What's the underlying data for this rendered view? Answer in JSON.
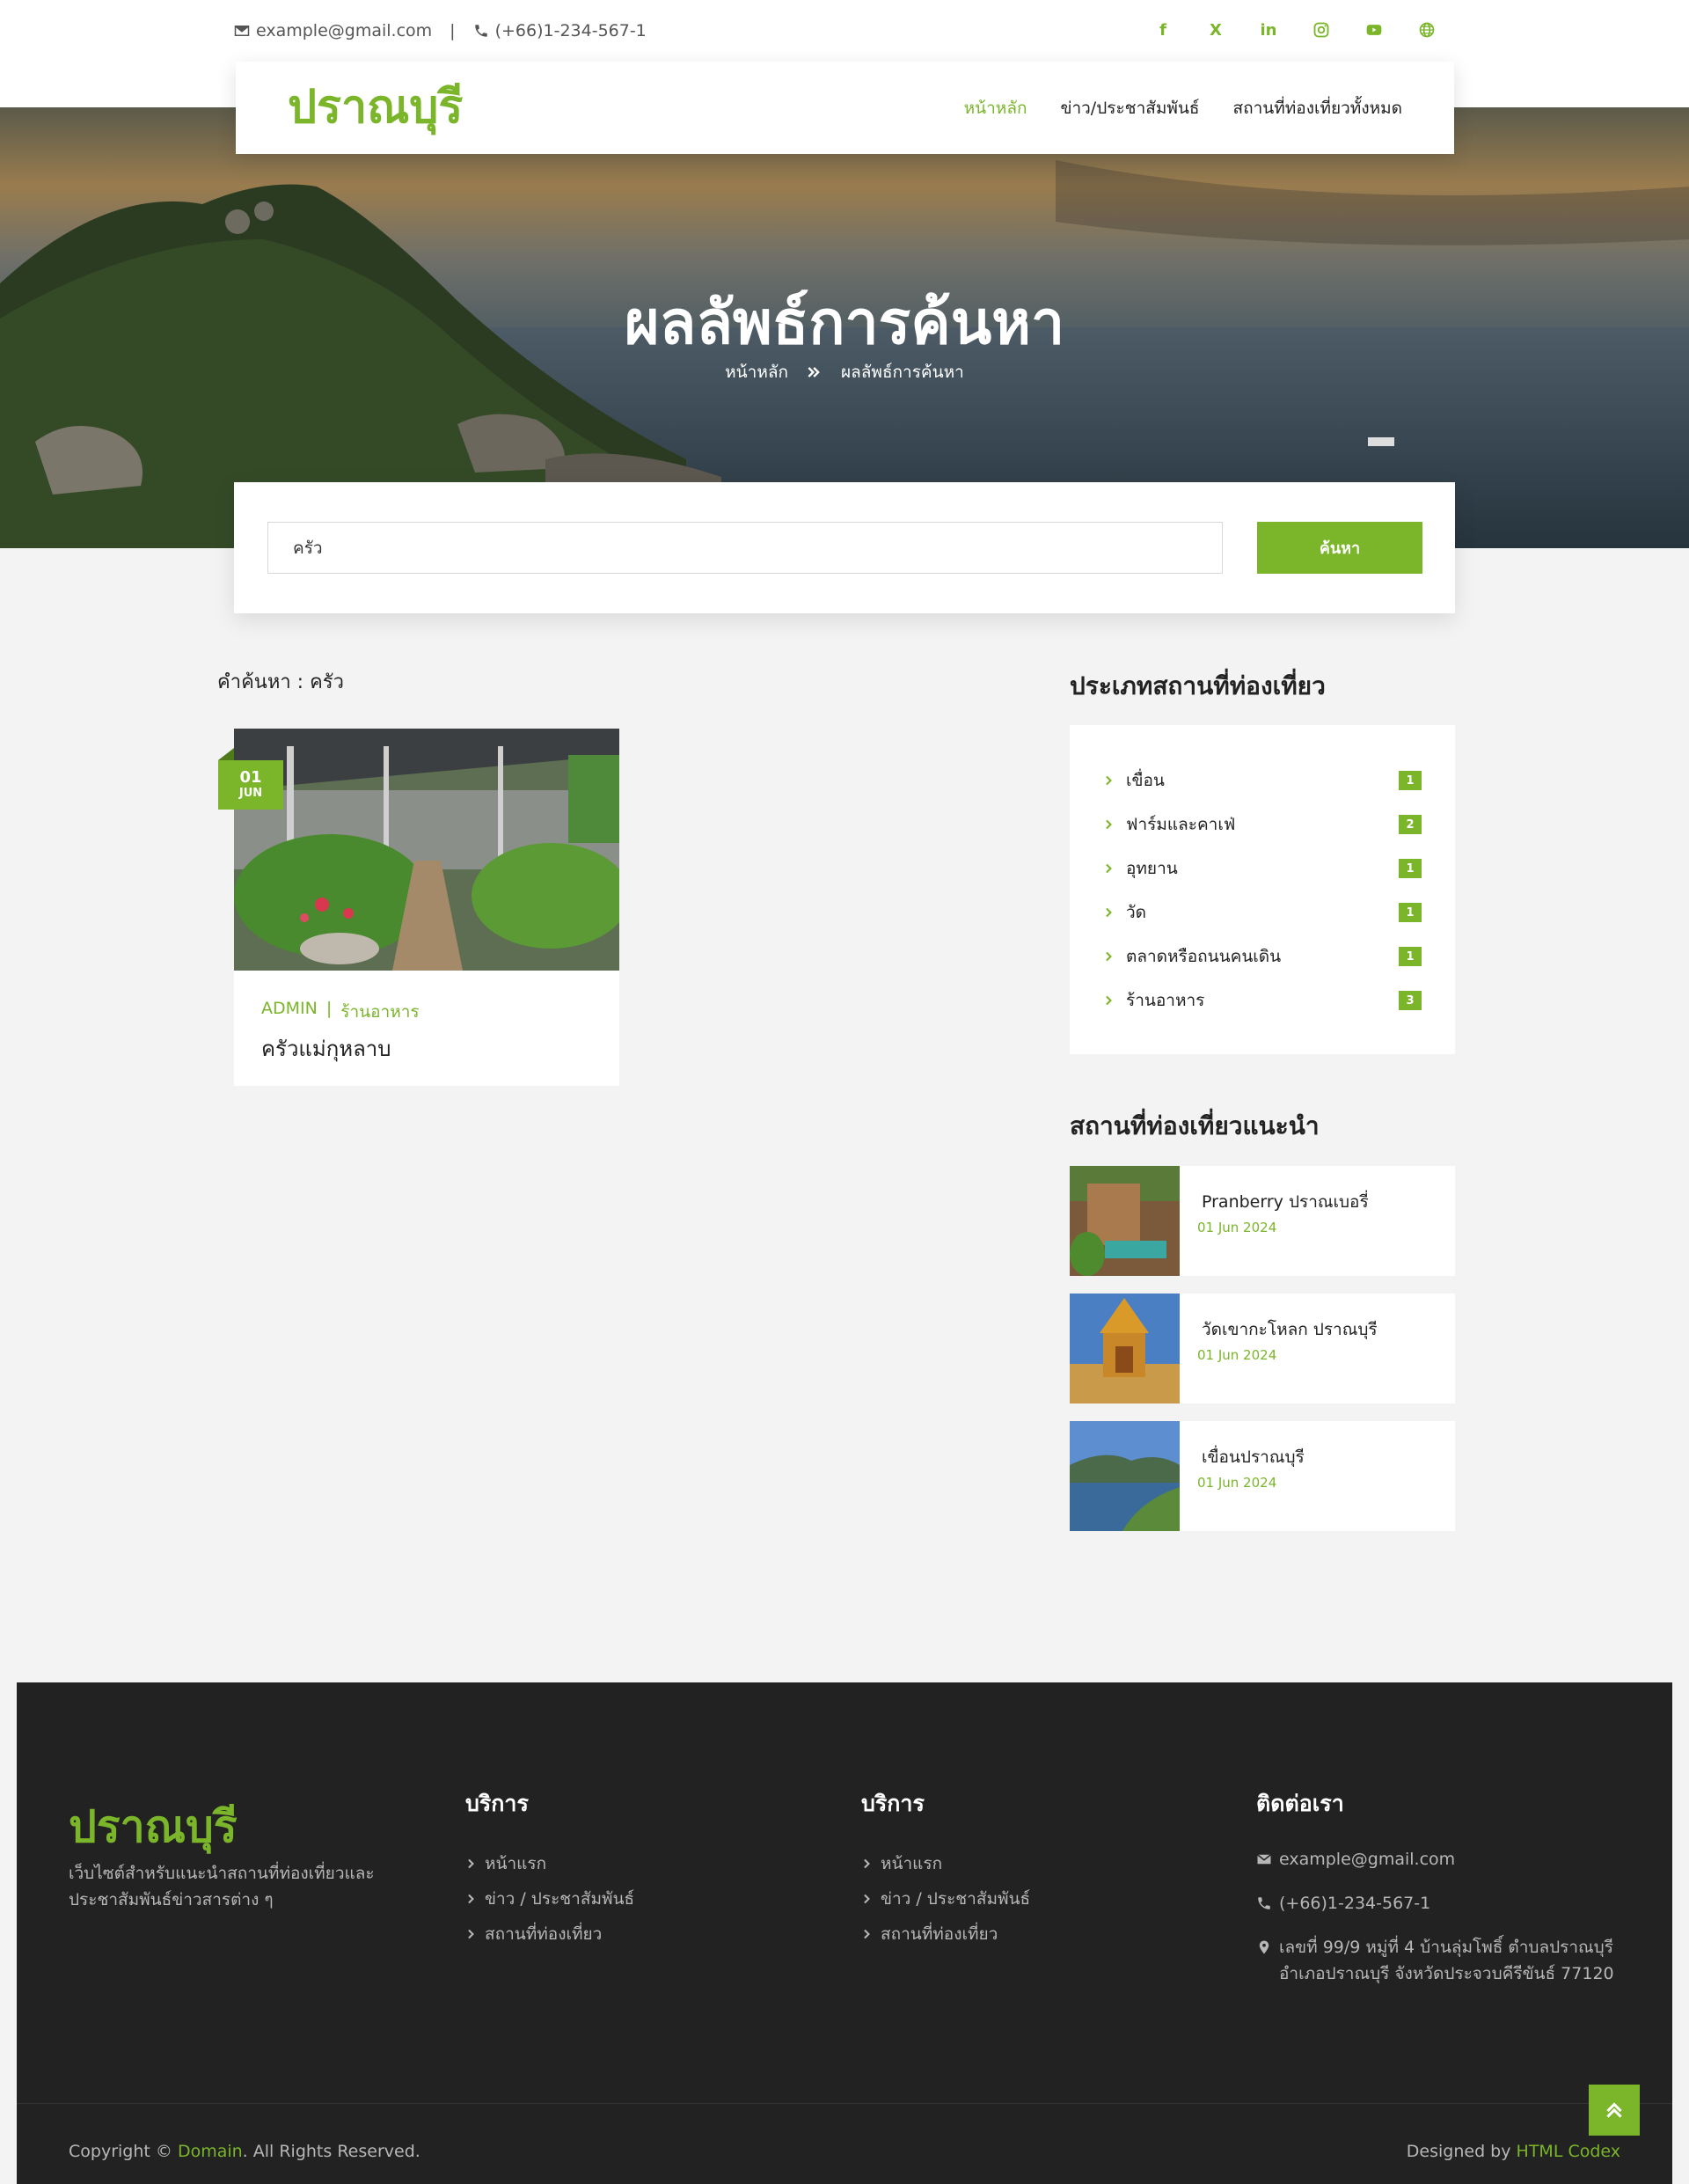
{
  "topbar": {
    "email": "example@gmail.com",
    "separator": "|",
    "phone": "(+66)1-234-567-1",
    "social": [
      {
        "icon": "facebook-icon",
        "glyph": "f"
      },
      {
        "icon": "x-icon",
        "glyph": "X"
      },
      {
        "icon": "linkedin-icon",
        "glyph": "in"
      },
      {
        "icon": "instagram-icon",
        "glyph": ""
      },
      {
        "icon": "youtube-icon",
        "glyph": ""
      },
      {
        "icon": "globe-icon",
        "glyph": ""
      }
    ]
  },
  "nav": {
    "logo": "ปราณบุรี",
    "links": [
      "หน้าหลัก",
      "ข่าว/ประชาสัมพันธ์",
      "สถานที่ท่องเที่ยวทั้งหมด"
    ],
    "active_index": 0
  },
  "hero": {
    "title": "ผลลัพธ์การค้นหา",
    "breadcrumb_home": "หน้าหลัก",
    "breadcrumb_current": "ผลลัพธ์การค้นหา"
  },
  "search": {
    "value": "ครัว",
    "button": "ค้นหา"
  },
  "results": {
    "query_label": "คำค้นหา : ครัว",
    "posts": [
      {
        "day": "01",
        "month": "JUN",
        "author": "ADMIN",
        "sep": "|",
        "category": "ร้านอาหาร",
        "title": "ครัวแม่กุหลาบ"
      }
    ]
  },
  "sidebar": {
    "categories_heading": "ประเภทสถานที่ท่องเที่ยว",
    "categories": [
      {
        "label": "เขื่อน",
        "count": "1"
      },
      {
        "label": "ฟาร์มและคาเฟ่",
        "count": "2"
      },
      {
        "label": "อุทยาน",
        "count": "1"
      },
      {
        "label": "วัด",
        "count": "1"
      },
      {
        "label": "ตลาดหรือถนนคนเดิน",
        "count": "1"
      },
      {
        "label": "ร้านอาหาร",
        "count": "3"
      }
    ],
    "recommended_heading": "สถานที่ท่องเที่ยวแนะนำ",
    "recommended": [
      {
        "title": "Pranberry ปราณเบอรี่",
        "date": "01 Jun 2024"
      },
      {
        "title": "วัดเขากะโหลก ปราณบุรี",
        "date": "01 Jun 2024"
      },
      {
        "title": "เขื่อนปราณบุรี",
        "date": "01 Jun 2024"
      }
    ]
  },
  "footer": {
    "logo": "ปราณบุรี",
    "description": "เว็บไซต์สำหรับแนะนำสถานที่ท่องเที่ยวและประชาสัมพันธ์ข่าวสารต่าง ๆ",
    "col1_title": "บริการ",
    "col1_links": [
      "หน้าแรก",
      "ข่าว / ประชาสัมพันธ์",
      "สถานที่ท่องเที่ยว"
    ],
    "col2_title": "บริการ",
    "col2_links": [
      "หน้าแรก",
      "ข่าว / ประชาสัมพันธ์",
      "สถานที่ท่องเที่ยว"
    ],
    "contact_title": "ติดต่อเรา",
    "contact_email": "example@gmail.com",
    "contact_phone": "(+66)1-234-567-1",
    "contact_address": "เลขที่ 99/9 หมู่ที่ 4 บ้านลุ่มโพธิ์ ตำบลปราณบุรี อำเภอปราณบุรี จังหวัดประจวบคีรีขันธ์ 77120",
    "copyright_prefix": "Copyright ©",
    "copyright_domain": "Domain",
    "copyright_suffix": ". All Rights Reserved.",
    "designed_prefix": "Designed by",
    "designed_link": "HTML Codex"
  },
  "colors": {
    "accent": "#7ab52a",
    "footer_bg": "#222222",
    "page_bg": "#f3f3f3"
  }
}
